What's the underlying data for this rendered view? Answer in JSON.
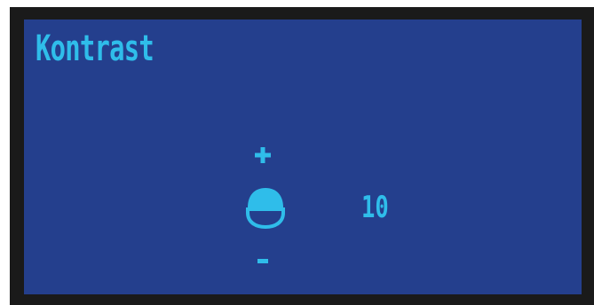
{
  "screen": {
    "title": "Kontrast",
    "value": "10",
    "colors": {
      "background": "#243f8d",
      "foreground": "#2fbdea",
      "bezel": "#1a1a1a"
    }
  },
  "controls": {
    "increase": {
      "icon": "plus-icon"
    },
    "decrease": {
      "icon": "minus-icon"
    },
    "knob": {
      "icon": "contrast-knob-icon"
    }
  }
}
